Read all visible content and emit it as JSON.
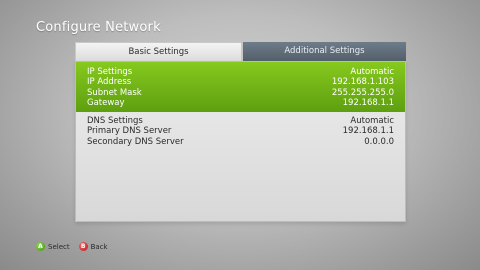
{
  "screen": {
    "title": "Configure Network"
  },
  "tabs": [
    {
      "label": "Basic Settings",
      "selected": true
    },
    {
      "label": "Additional Settings",
      "selected": false
    }
  ],
  "ip_settings": {
    "rows": [
      {
        "label": "IP Settings",
        "value": "Automatic"
      },
      {
        "label": "IP Address",
        "value": "192.168.1.103"
      },
      {
        "label": "Subnet Mask",
        "value": "255.255.255.0"
      },
      {
        "label": "Gateway",
        "value": "192.168.1.1"
      }
    ]
  },
  "dns_settings": {
    "rows": [
      {
        "label": "DNS Settings",
        "value": "Automatic"
      },
      {
        "label": "Primary DNS Server",
        "value": "192.168.1.1"
      },
      {
        "label": "Secondary DNS Server",
        "value": "0.0.0.0"
      }
    ]
  },
  "footer": {
    "select": {
      "button": "A",
      "label": "Select",
      "color": "#5cb82a"
    },
    "back": {
      "button": "B",
      "label": "Back",
      "color": "#d42a2a"
    }
  },
  "colors": {
    "highlight": "#7ab51d",
    "tab_inactive": "#5f6b77"
  }
}
